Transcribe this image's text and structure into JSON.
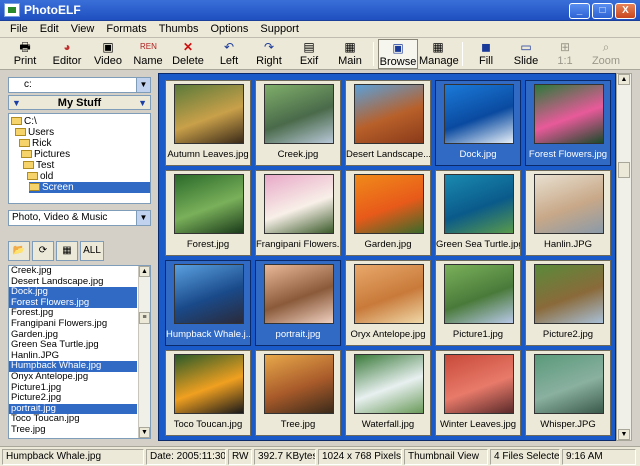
{
  "app": {
    "title": "PhotoELF"
  },
  "window_buttons": {
    "minimize": "_",
    "maximize": "□",
    "close": "X"
  },
  "menu": [
    "File",
    "Edit",
    "View",
    "Formats",
    "Thumbs",
    "Options",
    "Support"
  ],
  "toolbar": [
    {
      "label": "Print",
      "icon": "printer-icon"
    },
    {
      "label": "Editor",
      "icon": "palette-icon"
    },
    {
      "label": "Video",
      "icon": "camera-icon"
    },
    {
      "label": "Name",
      "icon": "rename-icon"
    },
    {
      "label": "Delete",
      "icon": "delete-icon"
    },
    {
      "label": "Left",
      "icon": "rotate-left-icon"
    },
    {
      "label": "Right",
      "icon": "rotate-right-icon"
    },
    {
      "label": "Exif",
      "icon": "exif-icon"
    },
    {
      "label": "Main",
      "icon": "main-icon"
    },
    {
      "label": "Browse",
      "icon": "browse-icon",
      "state": "pressed"
    },
    {
      "label": "Manage",
      "icon": "manage-icon"
    },
    {
      "label": "Fill",
      "icon": "fill-icon"
    },
    {
      "label": "Slide",
      "icon": "slide-icon"
    },
    {
      "label": "1:1",
      "icon": "one-to-one-icon",
      "state": "disabled"
    },
    {
      "label": "Zoom",
      "icon": "zoom-icon",
      "state": "disabled"
    }
  ],
  "drive": {
    "value": "c:"
  },
  "mystuff": {
    "label": "My Stuff"
  },
  "tree": [
    "C:\\",
    "Users",
    "Rick",
    "Pictures",
    "Test",
    "old",
    "Screen"
  ],
  "filter": {
    "value": "Photo, Video & Music"
  },
  "list_buttons": {
    "all": "ALL"
  },
  "files": [
    {
      "name": "Creek.jpg",
      "selected": false
    },
    {
      "name": "Desert Landscape.jpg",
      "selected": false
    },
    {
      "name": "Dock.jpg",
      "selected": true
    },
    {
      "name": "Forest Flowers.jpg",
      "selected": true
    },
    {
      "name": "Forest.jpg",
      "selected": false
    },
    {
      "name": "Frangipani Flowers.jpg",
      "selected": false
    },
    {
      "name": "Garden.jpg",
      "selected": false
    },
    {
      "name": "Green Sea Turtle.jpg",
      "selected": false
    },
    {
      "name": "Hanlin.JPG",
      "selected": false
    },
    {
      "name": "Humpback Whale.jpg",
      "selected": true
    },
    {
      "name": "Onyx Antelope.jpg",
      "selected": false
    },
    {
      "name": "Picture1.jpg",
      "selected": false
    },
    {
      "name": "Picture2.jpg",
      "selected": false
    },
    {
      "name": "portrait.jpg",
      "selected": true
    },
    {
      "name": "Toco Toucan.jpg",
      "selected": false
    },
    {
      "name": "Tree.jpg",
      "selected": false
    }
  ],
  "thumbnails": [
    {
      "caption": "Autumn Leaves.jpg",
      "state": "normal",
      "colors": [
        "#5b7a3a",
        "#c9a04a",
        "#3a2a18"
      ]
    },
    {
      "caption": "Creek.jpg",
      "state": "normal",
      "colors": [
        "#7fae6a",
        "#4a6a4a",
        "#b8c8d8"
      ]
    },
    {
      "caption": "Desert Landscape...",
      "state": "normal",
      "colors": [
        "#5ba0d8",
        "#b8602a",
        "#8a3a1a"
      ]
    },
    {
      "caption": "Dock.jpg",
      "state": "selected",
      "colors": [
        "#1b7ad8",
        "#0a4aa0",
        "#e8f0f8"
      ]
    },
    {
      "caption": "Forest Flowers.jpg",
      "state": "selected",
      "colors": [
        "#2a7a3a",
        "#e85a9a",
        "#1a4a2a"
      ]
    },
    {
      "caption": "Forest.jpg",
      "state": "normal",
      "colors": [
        "#2a6a2a",
        "#7ab05a",
        "#1a3a1a"
      ]
    },
    {
      "caption": "Frangipani Flowers...",
      "state": "normal",
      "colors": [
        "#e8a8c8",
        "#f8f0e8",
        "#3a5a2a"
      ]
    },
    {
      "caption": "Garden.jpg",
      "state": "normal",
      "colors": [
        "#f08a1a",
        "#e85a1a",
        "#3a6a2a"
      ]
    },
    {
      "caption": "Green Sea Turtle.jpg",
      "state": "normal",
      "colors": [
        "#1a8ab0",
        "#0a5a8a",
        "#5a9a4a"
      ]
    },
    {
      "caption": "Hanlin.JPG",
      "state": "normal",
      "colors": [
        "#e8e0d0",
        "#c8a888",
        "#8a9aa8"
      ]
    },
    {
      "caption": "Humpback Whale.j...",
      "state": "selected",
      "colors": [
        "#5aa0e0",
        "#1a4a8a",
        "#2a2a3a"
      ]
    },
    {
      "caption": "portrait.jpg",
      "state": "selected",
      "colors": [
        "#e8b898",
        "#8a5a3a",
        "#f0d0c0"
      ]
    },
    {
      "caption": "Oryx Antelope.jpg",
      "state": "normal",
      "colors": [
        "#e8a86a",
        "#c87a3a",
        "#f0d8a8"
      ]
    },
    {
      "caption": "Picture1.jpg",
      "state": "normal",
      "colors": [
        "#7ab05a",
        "#4a7a3a",
        "#b8c8e8"
      ]
    },
    {
      "caption": "Picture2.jpg",
      "state": "normal",
      "colors": [
        "#5a8a3a",
        "#8a6a3a",
        "#a8c0d8"
      ]
    },
    {
      "caption": "Toco Toucan.jpg",
      "state": "normal",
      "colors": [
        "#2a5a2a",
        "#f0a020",
        "#1a1a1a"
      ]
    },
    {
      "caption": "Tree.jpg",
      "state": "normal",
      "colors": [
        "#e8a84a",
        "#a85a2a",
        "#3a2a1a"
      ]
    },
    {
      "caption": "Waterfall.jpg",
      "state": "normal",
      "colors": [
        "#3a7a3a",
        "#e8f0f0",
        "#6a9a5a"
      ]
    },
    {
      "caption": "Winter Leaves.jpg",
      "state": "normal",
      "colors": [
        "#c84a3a",
        "#e87a6a",
        "#5a2a2a"
      ]
    },
    {
      "caption": "Whisper.JPG",
      "state": "normal",
      "colors": [
        "#5a9a7a",
        "#8ab0a0",
        "#3a5a4a"
      ]
    }
  ],
  "status": {
    "file": "Humpback Whale.jpg",
    "date": "Date: 2005:11:30",
    "mode": "RW",
    "size": "392.7 KBytes",
    "dimensions": "1024 x 768 Pixels",
    "view": "Thumbnail View",
    "selection": "4 Files Selected",
    "time": "9:16 AM"
  }
}
